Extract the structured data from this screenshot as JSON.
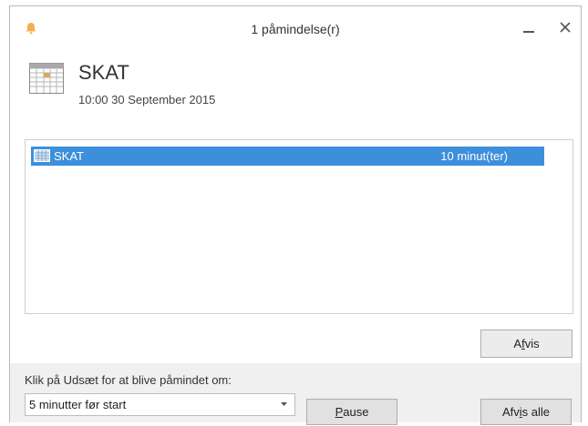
{
  "window": {
    "title": "1 påmindelse(r)"
  },
  "reminder": {
    "subject": "SKAT",
    "datetime": "10:00 30 September 2015"
  },
  "list": {
    "items": [
      {
        "name": "SKAT",
        "due": "10 minut(ter)"
      }
    ]
  },
  "buttons": {
    "dismiss_pre": "A",
    "dismiss_u": "f",
    "dismiss_post": "vis",
    "pause_u": "P",
    "pause_post": "ause",
    "dismiss_all_pre": "Afv",
    "dismiss_all_u": "i",
    "dismiss_all_post": "s alle"
  },
  "snooze": {
    "label": "Klik på Udsæt for at blive påmindet om:",
    "selected": "5 minutter før start"
  },
  "colors": {
    "selection": "#3d8fdc",
    "bell": "#f2b04f"
  }
}
